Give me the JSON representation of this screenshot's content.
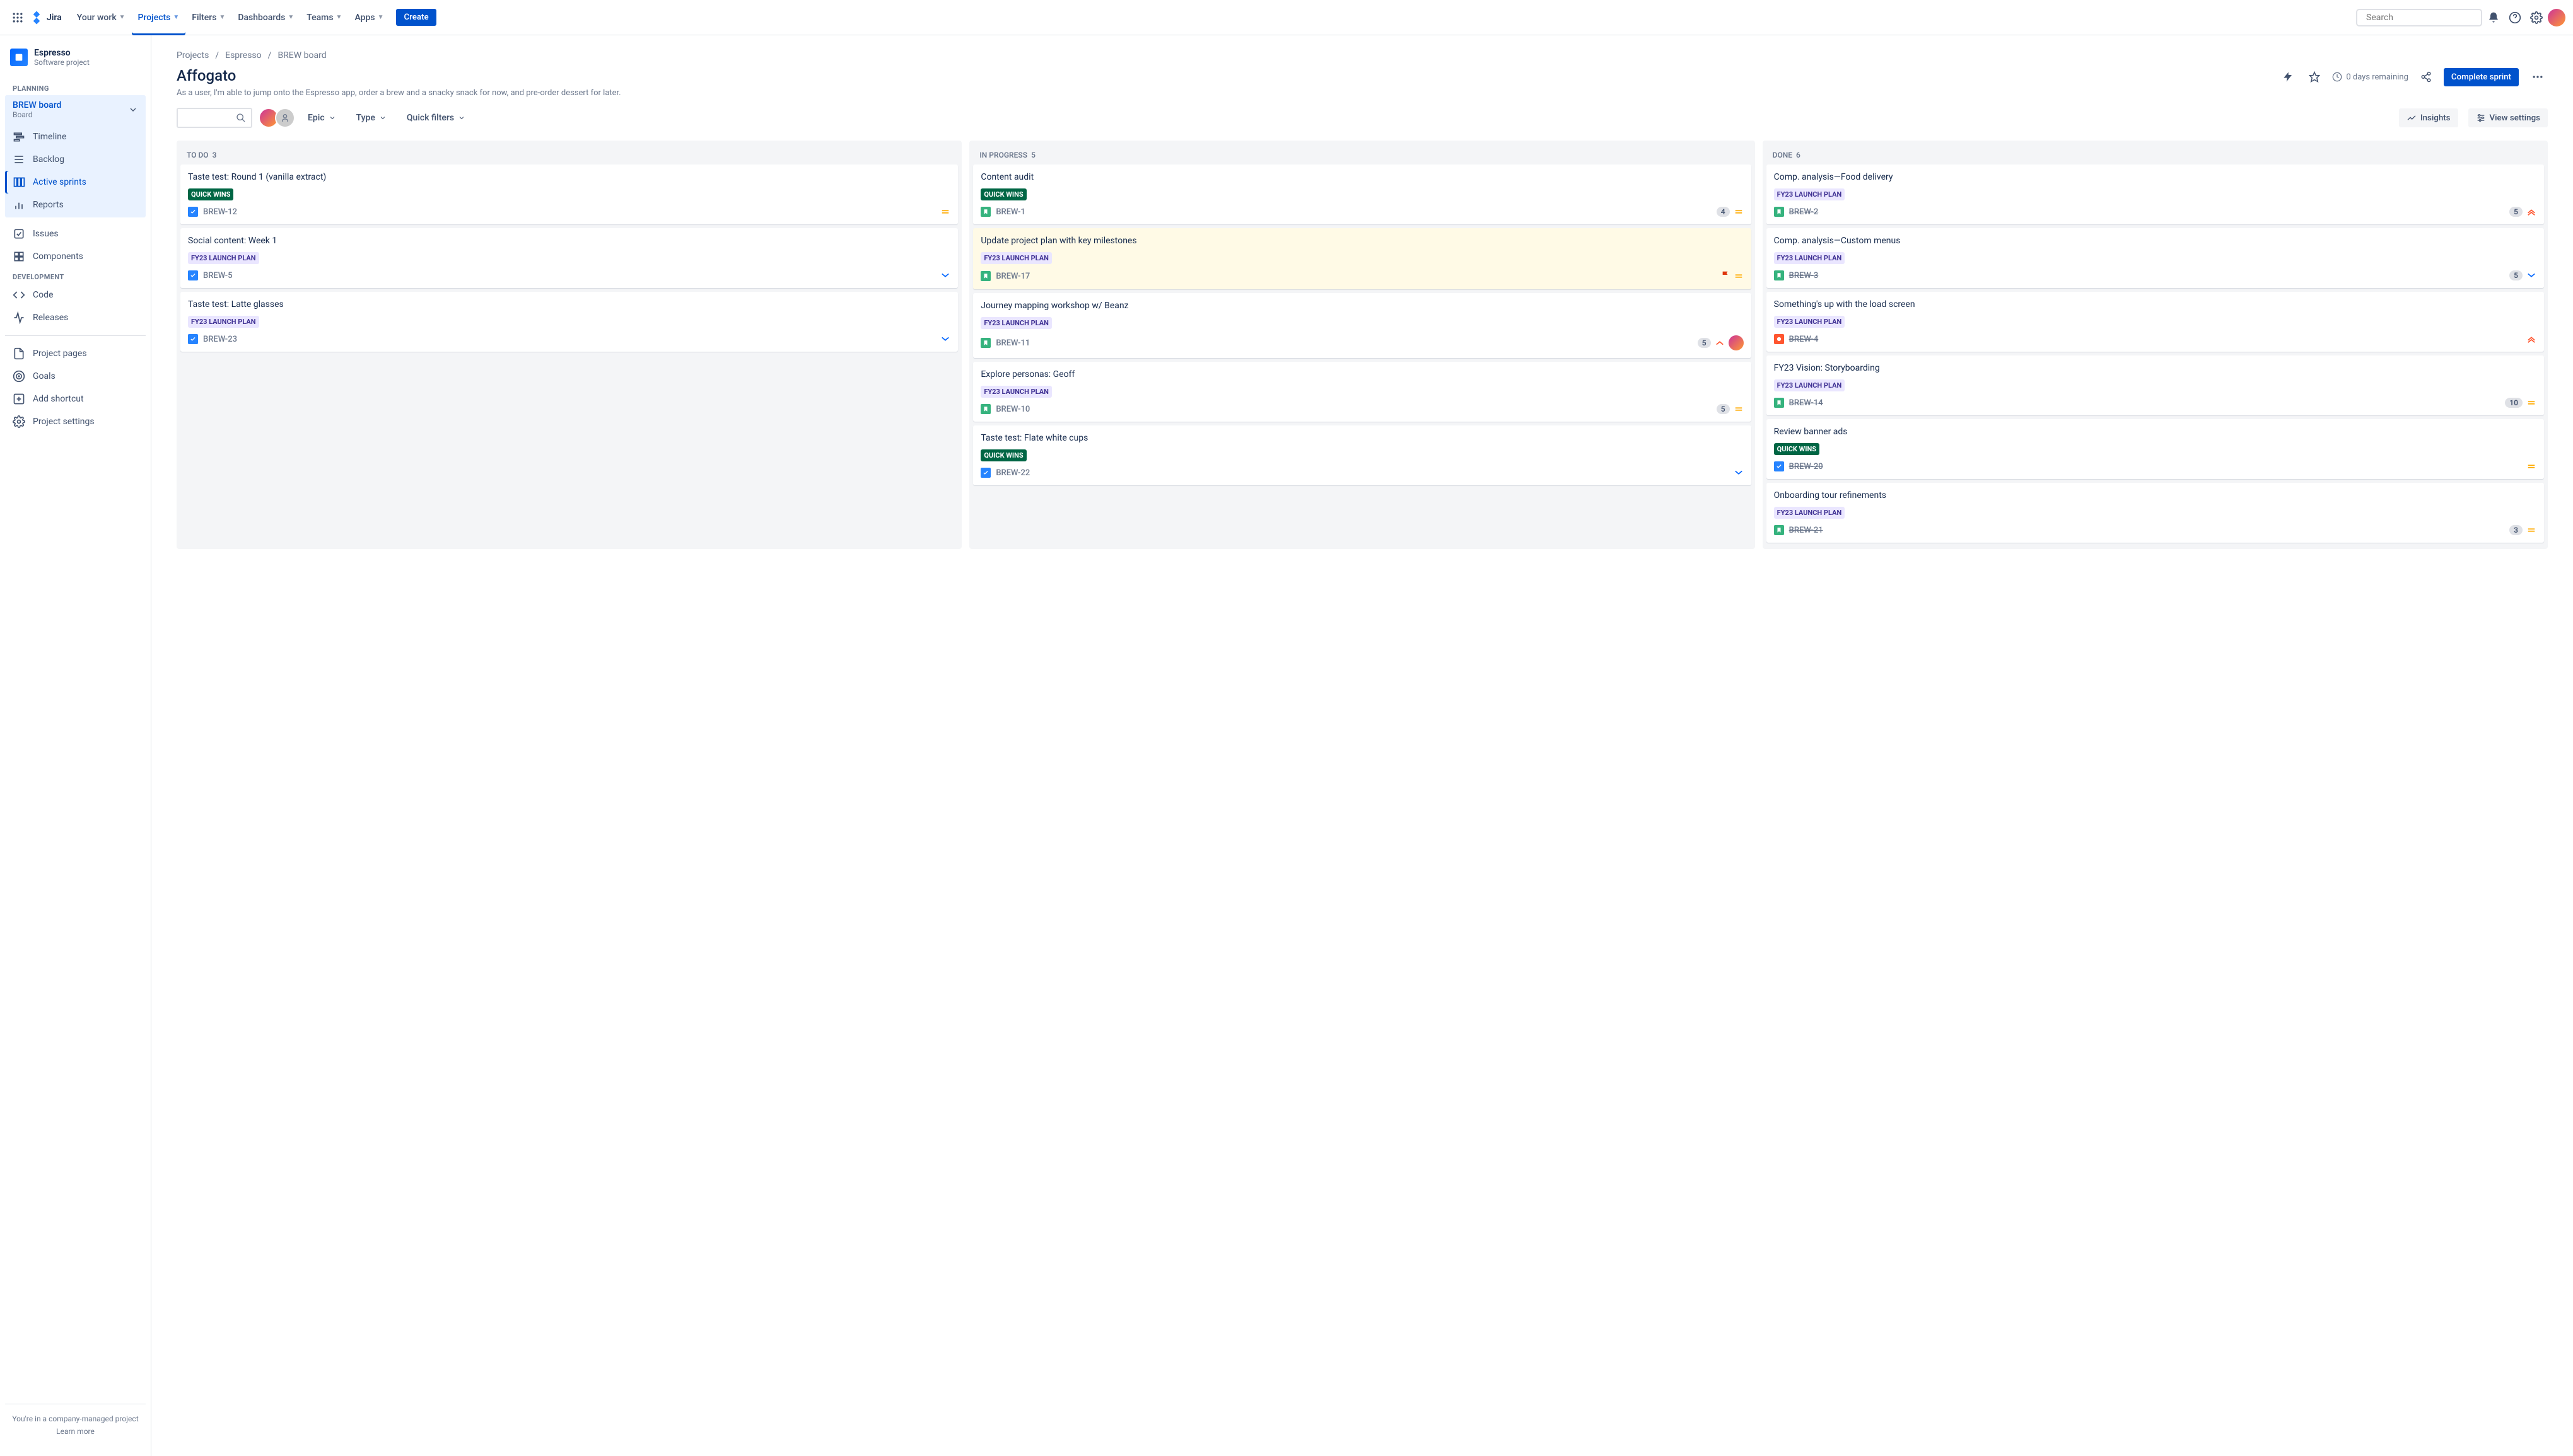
{
  "topnav": {
    "logo": "Jira",
    "items": [
      "Your work",
      "Projects",
      "Filters",
      "Dashboards",
      "Teams",
      "Apps"
    ],
    "active_index": 1,
    "create": "Create",
    "search_placeholder": "Search"
  },
  "sidebar": {
    "project_name": "Espresso",
    "project_type": "Software project",
    "sections": {
      "planning": "PLANNING",
      "development": "DEVELOPMENT"
    },
    "board": {
      "title": "BREW board",
      "sub": "Board"
    },
    "planning_items": [
      "Timeline",
      "Backlog",
      "Active sprints",
      "Reports"
    ],
    "planning_active": 2,
    "other_items": [
      "Issues",
      "Components"
    ],
    "dev_items": [
      "Code",
      "Releases"
    ],
    "bottom_items": [
      "Project pages",
      "Goals",
      "Add shortcut",
      "Project settings"
    ],
    "footer1": "You're in a company-managed project",
    "footer2": "Learn more"
  },
  "breadcrumb": [
    "Projects",
    "Espresso",
    "BREW board"
  ],
  "header": {
    "title": "Affogato",
    "desc": "As a user, I'm able to jump onto the Espresso app, order a brew and a snacky snack for now, and pre-order dessert for later.",
    "days_remaining": "0 days remaining",
    "complete": "Complete sprint"
  },
  "toolbar": {
    "filters": [
      "Epic",
      "Type",
      "Quick filters"
    ],
    "insights": "Insights",
    "view_settings": "View settings"
  },
  "columns": [
    {
      "title": "TO DO",
      "count": "3"
    },
    {
      "title": "IN PROGRESS",
      "count": "5"
    },
    {
      "title": "DONE",
      "count": "6"
    }
  ],
  "tags": {
    "quick_wins": "QUICK WINS",
    "fy23": "FY23 LAUNCH PLAN"
  },
  "cards": {
    "todo": [
      {
        "title": "Taste test: Round 1 (vanilla extract)",
        "tag": "green",
        "key": "BREW-12",
        "type": "task",
        "prio": "medium"
      },
      {
        "title": "Social content: Week 1",
        "tag": "purple",
        "key": "BREW-5",
        "type": "task",
        "prio": "low"
      },
      {
        "title": "Taste test: Latte glasses",
        "tag": "purple",
        "key": "BREW-23",
        "type": "task",
        "prio": "low"
      }
    ],
    "inprogress": [
      {
        "title": "Content audit",
        "tag": "green",
        "key": "BREW-1",
        "type": "story",
        "points": "4",
        "prio": "medium"
      },
      {
        "title": "Update project plan with key milestones",
        "tag": "purple",
        "key": "BREW-17",
        "type": "story",
        "prio": "medium",
        "highlight": true,
        "flag": true
      },
      {
        "title": "Journey mapping workshop w/ Beanz",
        "tag": "purple",
        "key": "BREW-11",
        "type": "story",
        "points": "5",
        "prio": "high",
        "assignee": true
      },
      {
        "title": "Explore personas: Geoff",
        "tag": "purple",
        "key": "BREW-10",
        "type": "story",
        "points": "5",
        "prio": "medium"
      },
      {
        "title": "Taste test: Flate white cups",
        "tag": "green",
        "key": "BREW-22",
        "type": "task",
        "prio": "low"
      }
    ],
    "done": [
      {
        "title": "Comp. analysis—Food delivery",
        "tag": "purple",
        "key": "BREW-2",
        "type": "story",
        "points": "5",
        "prio": "highest",
        "done": true
      },
      {
        "title": "Comp. analysis—Custom menus",
        "tag": "purple",
        "key": "BREW-3",
        "type": "story",
        "points": "5",
        "prio": "low",
        "done": true
      },
      {
        "title": "Something's up with the load screen",
        "tag": "purple",
        "key": "BREW-4",
        "type": "bug",
        "prio": "highest",
        "done": true
      },
      {
        "title": "FY23 Vision: Storyboarding",
        "tag": "purple",
        "key": "BREW-14",
        "type": "story",
        "points": "10",
        "prio": "medium",
        "done": true
      },
      {
        "title": "Review banner ads",
        "tag": "green",
        "key": "BREW-20",
        "type": "task",
        "prio": "medium",
        "done": true
      },
      {
        "title": "Onboarding tour refinements",
        "tag": "purple",
        "key": "BREW-21",
        "type": "story",
        "points": "3",
        "prio": "medium",
        "done": true
      }
    ]
  }
}
